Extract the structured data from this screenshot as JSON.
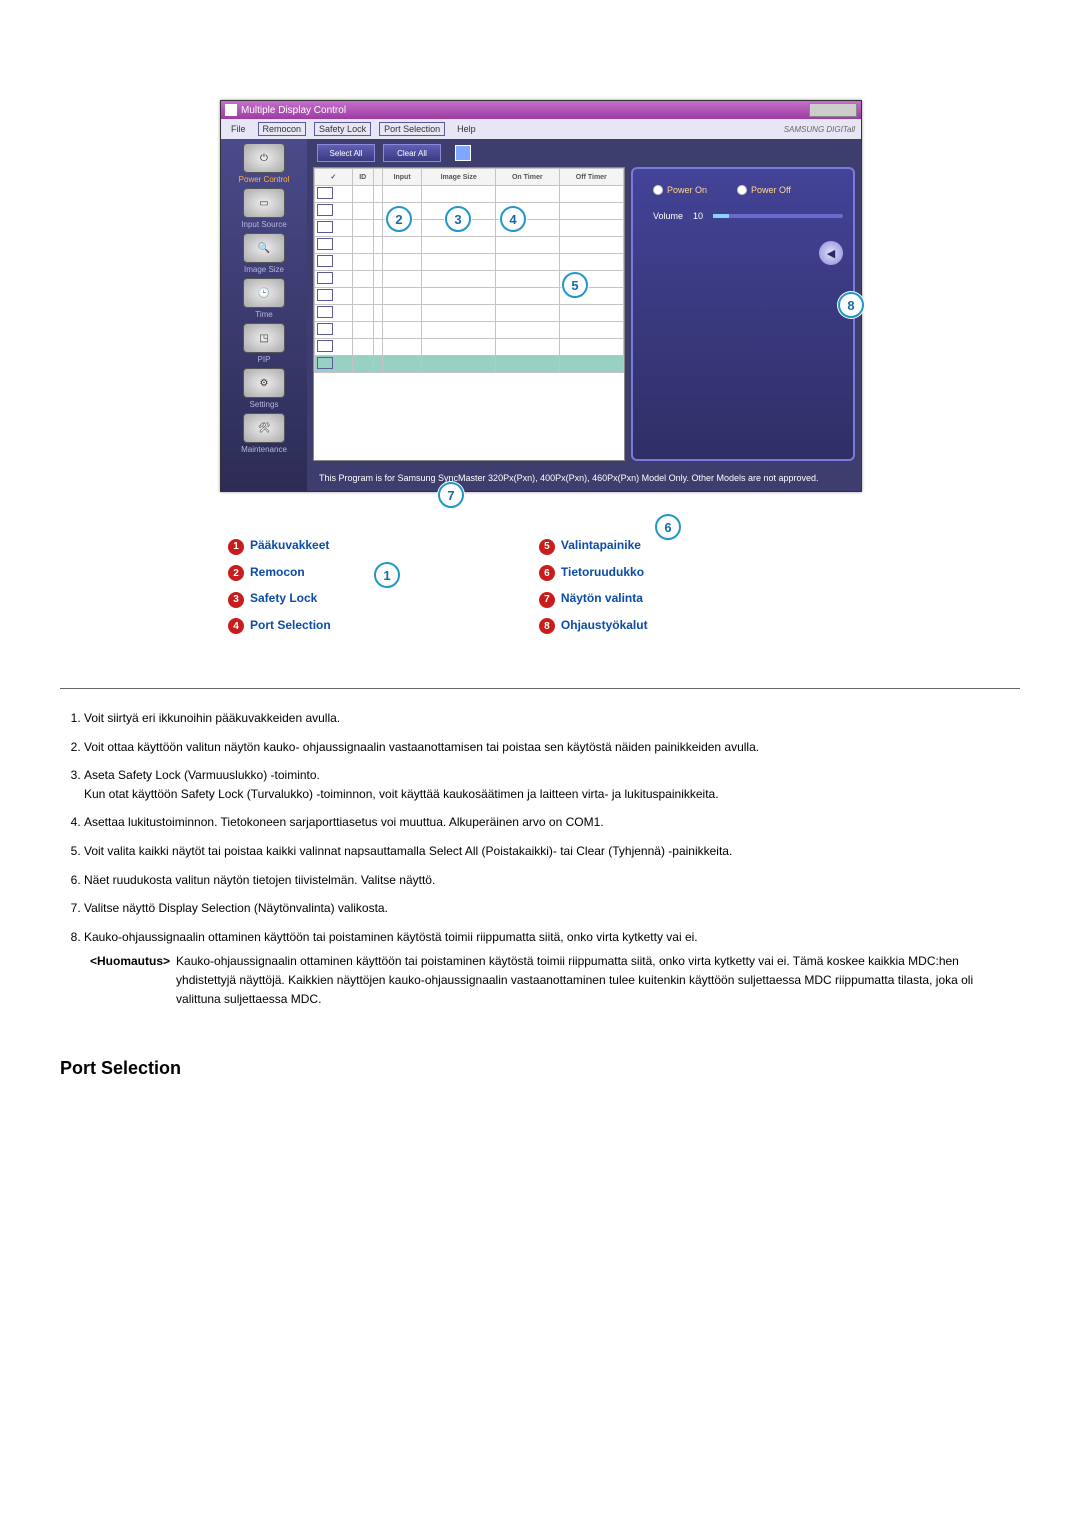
{
  "app": {
    "title": "Multiple Display Control",
    "brand": "SAMSUNG DIGITall"
  },
  "menu": {
    "file": "File",
    "remocon": "Remocon",
    "safety": "Safety Lock",
    "port": "Port Selection",
    "help": "Help"
  },
  "sidebar": {
    "items": [
      {
        "label": "Power Control"
      },
      {
        "label": "Input Source"
      },
      {
        "label": "Image Size"
      },
      {
        "label": "Time"
      },
      {
        "label": "PIP"
      },
      {
        "label": "Settings"
      },
      {
        "label": "Maintenance"
      }
    ]
  },
  "toolbar": {
    "select_all": "Select All",
    "clear_all": "Clear All"
  },
  "grid": {
    "headers": {
      "chk": "✓",
      "id": "ID",
      "sel": "",
      "input": "Input",
      "image": "Image Size",
      "onTimer": "On Timer",
      "offTimer": "Off Timer"
    }
  },
  "panel": {
    "power_on": "Power On",
    "power_off": "Power Off",
    "volume_label": "Volume",
    "volume_value": "10"
  },
  "noteText": "This Program is for Samsung SyncMaster 320Px(Pxn), 400Px(Pxn), 460Px(Pxn)  Model Only. Other Models are not approved.",
  "callouts": {
    "1": "1",
    "2": "2",
    "3": "3",
    "4": "4",
    "5": "5",
    "6": "6",
    "7": "7",
    "8": "8"
  },
  "legend": {
    "1": "Pääkuvakkeet",
    "2": "Remocon",
    "3": "Safety Lock",
    "4": "Port Selection",
    "5": "Valintapainike",
    "6": "Tietoruudukko",
    "7": "Näytön valinta",
    "8": "Ohjaustyökalut"
  },
  "list": {
    "1": "Voit siirtyä eri ikkunoihin pääkuvakkeiden avulla.",
    "2": "Voit ottaa käyttöön valitun näytön kauko- ohjaussignaalin vastaanottamisen tai poistaa sen käytöstä näiden painikkeiden avulla.",
    "3": "Aseta Safety Lock (Varmuuslukko) -toiminto.",
    "3b": "Kun otat käyttöön Safety Lock (Turvalukko) -toiminnon, voit käyttää kaukosäätimen ja laitteen virta- ja lukituspainikkeita.",
    "4": "Asettaa lukitustoiminnon. Tietokoneen sarjaporttiasetus voi muuttua. Alkuperäinen arvo on COM1.",
    "5": "Voit valita kaikki näytöt tai poistaa kaikki valinnat napsauttamalla Select All (Poistakaikki)- tai Clear (Tyhjennä) -painikkeita.",
    "6": "Näet ruudukosta valitun näytön tietojen tiivistelmän. Valitse näyttö.",
    "7": "Valitse näyttö Display Selection (Näytönvalinta) valikosta.",
    "8": "Kauko-ohjaussignaalin ottaminen käyttöön tai poistaminen käytöstä toimii riippumatta siitä, onko virta kytketty vai ei.",
    "note_label": "<Huomautus>",
    "note_body": "Kauko-ohjaussignaalin ottaminen käyttöön tai poistaminen käytöstä toimii riippumatta siitä, onko virta kytketty vai ei. Tämä koskee kaikkia MDC:hen yhdistettyjä näyttöjä. Kaikkien näyttöjen kauko-ohjaussignaalin vastaanottaminen tulee kuitenkin käyttöön suljettaessa MDC riippumatta tilasta, joka oli valittuna suljettaessa MDC."
  },
  "section_title": "Port Selection"
}
